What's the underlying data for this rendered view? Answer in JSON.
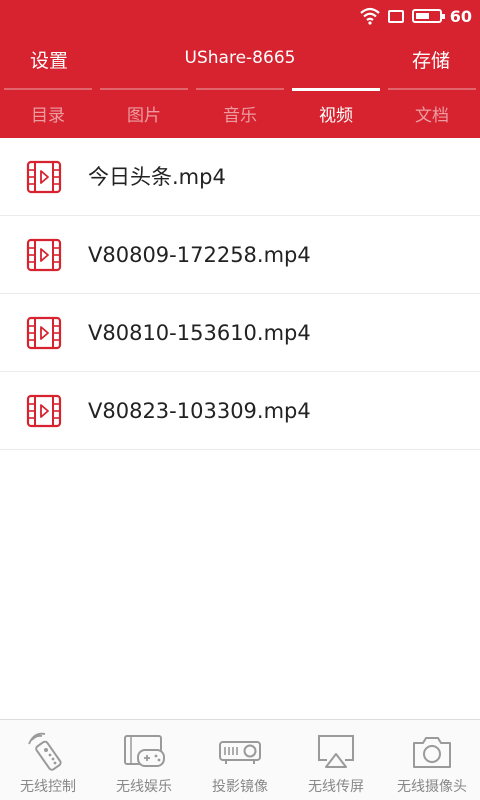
{
  "status_bar": {
    "battery_text": "60",
    "battery_level": 0.6
  },
  "top_bar": {
    "settings_label": "设置",
    "title": "UShare-8665",
    "storage_label": "存储"
  },
  "tabs": [
    {
      "label": "目录",
      "active": false
    },
    {
      "label": "图片",
      "active": false
    },
    {
      "label": "音乐",
      "active": false
    },
    {
      "label": "视频",
      "active": true
    },
    {
      "label": "文档",
      "active": false
    }
  ],
  "files": [
    {
      "name": "今日头条.mp4",
      "icon": "video-file-icon"
    },
    {
      "name": "V80809-172258.mp4",
      "icon": "video-file-icon"
    },
    {
      "name": "V80810-153610.mp4",
      "icon": "video-file-icon"
    },
    {
      "name": "V80823-103309.mp4",
      "icon": "video-file-icon"
    }
  ],
  "bottom_nav": [
    {
      "label": "无线控制",
      "icon": "remote-control-icon"
    },
    {
      "label": "无线娱乐",
      "icon": "gamepad-icon"
    },
    {
      "label": "投影镜像",
      "icon": "projector-icon"
    },
    {
      "label": "无线传屏",
      "icon": "airplay-icon"
    },
    {
      "label": "无线摄像头",
      "icon": "camera-icon"
    }
  ],
  "colors": {
    "accent": "#d6232f",
    "icon_gray": "#9a9a9a"
  }
}
